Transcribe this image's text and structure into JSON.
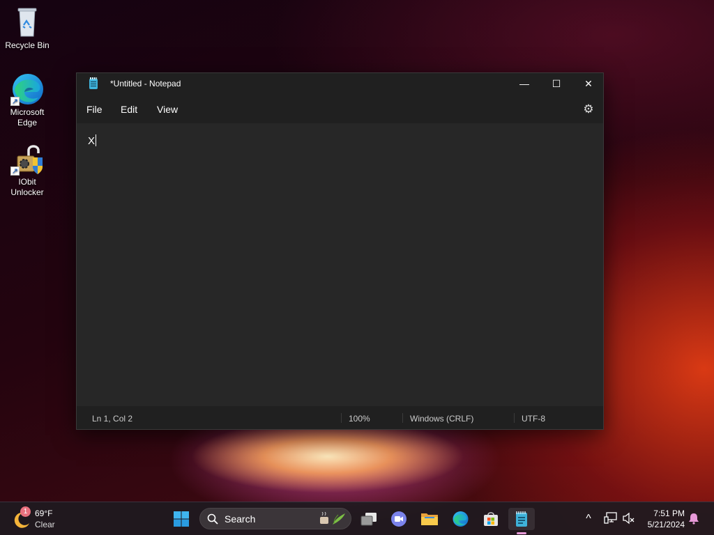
{
  "desktop": {
    "icons": [
      {
        "label_line1": "Recycle Bin",
        "label_line2": ""
      },
      {
        "label_line1": "Microsoft",
        "label_line2": "Edge"
      },
      {
        "label_line1": "IObit",
        "label_line2": "Unlocker"
      }
    ]
  },
  "window": {
    "title": "*Untitled - Notepad",
    "controls": {
      "minimize": "—",
      "maximize": "☐",
      "close": "✕"
    },
    "menu": [
      "File",
      "Edit",
      "View"
    ],
    "editor_text": "X",
    "status": {
      "position": "Ln 1, Col 2",
      "zoom": "100%",
      "line_ending": "Windows (CRLF)",
      "encoding": "UTF-8"
    }
  },
  "taskbar": {
    "weather": {
      "badge": "1",
      "temp": "69°F",
      "condition": "Clear"
    },
    "search_label": "Search",
    "clock": {
      "time": "7:51 PM",
      "date": "5/21/2024"
    },
    "tray_chevron": "^"
  },
  "colors": {
    "notepad_icon": "#3fb2d9",
    "editor_bg": "#272727",
    "window_bg": "#202020",
    "taskbar_bg": "#1e1a20"
  }
}
